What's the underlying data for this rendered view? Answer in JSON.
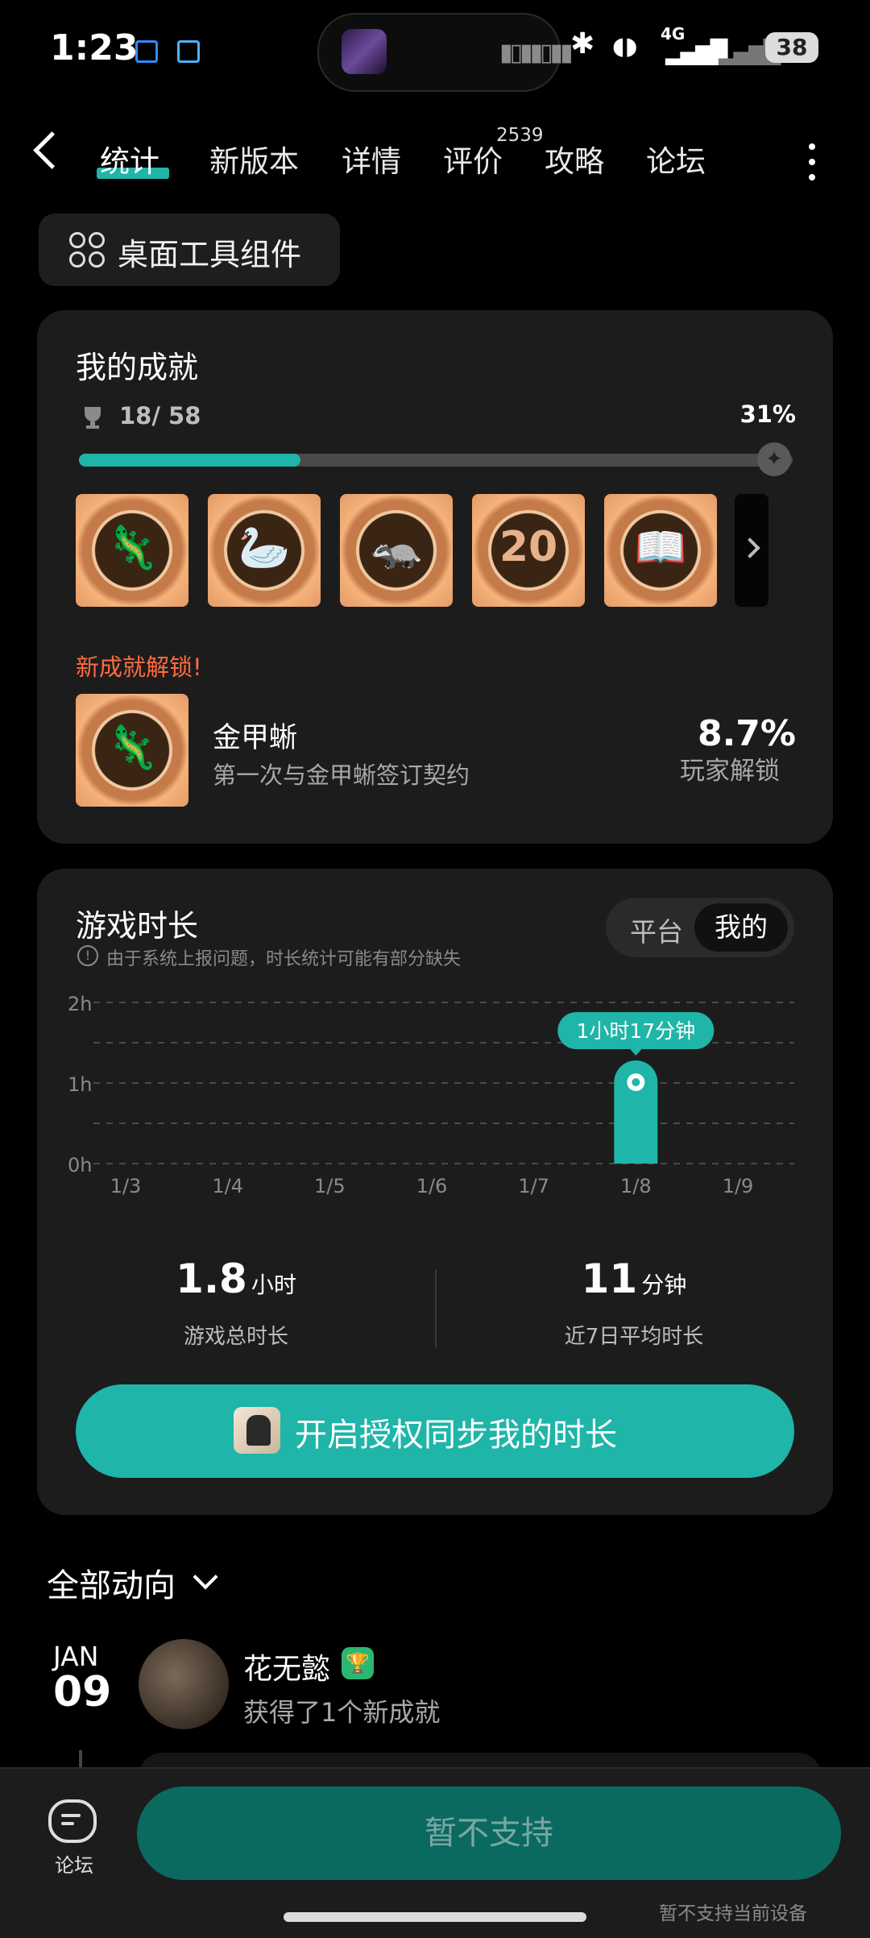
{
  "status_bar": {
    "time": "1:23",
    "battery": "38",
    "network": "4G"
  },
  "nav": {
    "tabs": [
      {
        "label": "统计"
      },
      {
        "label": "新版本"
      },
      {
        "label": "详情"
      },
      {
        "label": "评价"
      },
      {
        "label": "攻略"
      },
      {
        "label": "论坛"
      }
    ],
    "review_count": "2539"
  },
  "widget_button": {
    "label": "桌面工具组件"
  },
  "achievements": {
    "title": "我的成就",
    "progress_text": "18/ 58",
    "percent_text": "31%",
    "progress_fraction": 0.31,
    "badges": [
      {
        "icon": "lizard-badge-icon",
        "glyph": "🦎"
      },
      {
        "icon": "swan-badge-icon",
        "glyph": "🦢"
      },
      {
        "icon": "ferret-badge-icon",
        "glyph": "🦡"
      },
      {
        "icon": "twenty-badge-icon",
        "glyph": "20"
      },
      {
        "icon": "book-badge-icon",
        "glyph": "📖"
      }
    ],
    "new_unlock_label": "新成就解锁!",
    "latest": {
      "name": "金甲蜥",
      "description": "第一次与金甲蜥签订契约",
      "rate": "8.7%",
      "rate_label": "玩家解锁",
      "icon": "lizard-badge-icon",
      "glyph": "🦎"
    }
  },
  "playtime": {
    "title": "游戏时长",
    "toggle_left": "平台",
    "toggle_right": "我的",
    "notice": "由于系统上报问题，时长统计可能有部分缺失",
    "total_value": "1.8",
    "total_unit": "小时",
    "total_label": "游戏总时长",
    "avg_value": "11",
    "avg_unit": "分钟",
    "avg_label": "近7日平均时长",
    "sync_button": "开启授权同步我的时长"
  },
  "chart_data": {
    "type": "bar",
    "categories": [
      "1/3",
      "1/4",
      "1/5",
      "1/6",
      "1/7",
      "1/8",
      "1/9"
    ],
    "values": [
      0,
      0,
      0,
      0,
      0,
      1.28,
      0
    ],
    "y_ticks": [
      "0h",
      "1h",
      "2h"
    ],
    "ylim": [
      0,
      2
    ],
    "highlight": {
      "category": "1/8",
      "label": "1小时17分钟"
    },
    "colors": {
      "bar": "#1fb5a8",
      "grid": "#4a4a4a",
      "tick": "#8a8a8a"
    }
  },
  "feed": {
    "title": "全部动向",
    "month": "JAN",
    "day": "09",
    "user": "花无懿",
    "text": "获得了1个新成就"
  },
  "bottom": {
    "forum_label": "论坛",
    "button": "暂不支持",
    "note": "暂不支持当前设备"
  },
  "colors": {
    "accent": "#1fb5a8",
    "alert": "#ff6b3d"
  }
}
